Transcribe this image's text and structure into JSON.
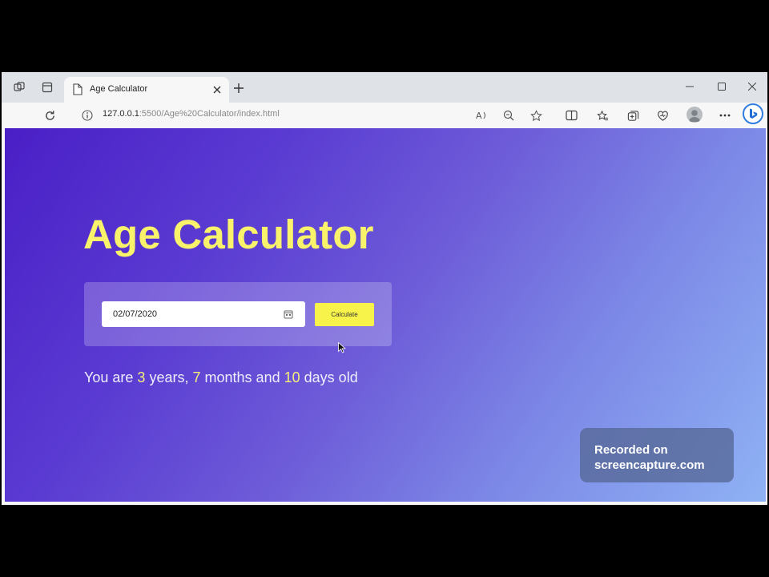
{
  "browser": {
    "tab": {
      "title": "Age Calculator"
    },
    "address": {
      "host": "127.0.0.1",
      "port_and_path": ":5500/Age%20Calculator/index.html"
    }
  },
  "page": {
    "title": "Age Calculator",
    "date_input_value": "02/07/2020",
    "calculate_label": "Calculate",
    "result": {
      "prefix": "You are",
      "years": "3",
      "years_label": "years,",
      "months": "7",
      "months_label": "months and",
      "days": "10",
      "days_label": "days old"
    }
  },
  "watermark": {
    "line1": "Recorded on",
    "line2": "screencapture.com"
  },
  "colors": {
    "title_yellow": "#f9f36b",
    "button_yellow": "#f7f34a",
    "gradient_start": "#4a1fc6",
    "gradient_end": "#8fb2f4"
  }
}
